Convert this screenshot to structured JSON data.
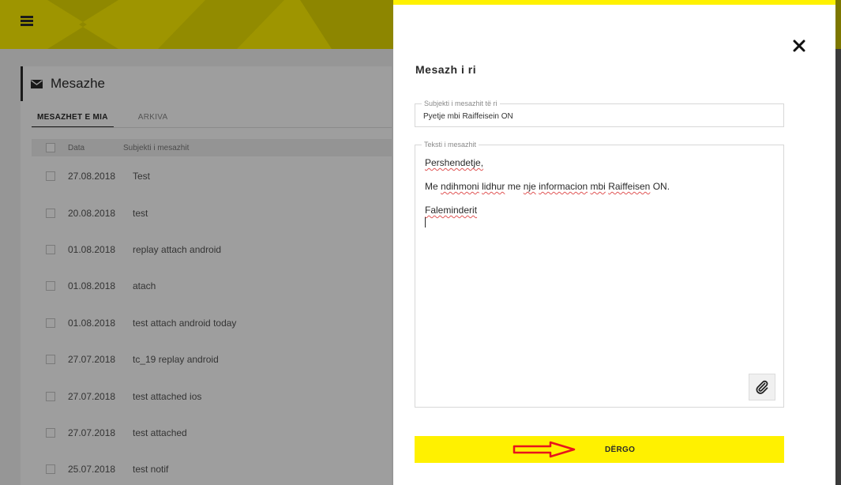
{
  "background": {
    "section_title": "Mesazhe",
    "tabs": [
      {
        "label": "MESAZHET E MIA",
        "active": true
      },
      {
        "label": "ARKIVA",
        "active": false
      }
    ],
    "table": {
      "headers": {
        "date": "Data",
        "subject": "Subjekti i mesazhit"
      },
      "rows": [
        {
          "date": "27.08.2018",
          "subject": "Test"
        },
        {
          "date": "20.08.2018",
          "subject": "test"
        },
        {
          "date": "01.08.2018",
          "subject": "replay attach android"
        },
        {
          "date": "01.08.2018",
          "subject": "atach"
        },
        {
          "date": "01.08.2018",
          "subject": "test attach android today"
        },
        {
          "date": "27.07.2018",
          "subject": "tc_19 replay android"
        },
        {
          "date": "27.07.2018",
          "subject": "test attached ios"
        },
        {
          "date": "27.07.2018",
          "subject": "test attached"
        },
        {
          "date": "25.07.2018",
          "subject": "test notif"
        }
      ]
    }
  },
  "modal": {
    "title": "Mesazh i ri",
    "subject_field": {
      "label": "Subjekti i mesazhit të ri",
      "value": "Pyetje mbi Raiffeisein ON"
    },
    "body_field": {
      "label": "Teksti i mesazhit",
      "lines": {
        "line1": "Pershendetje,",
        "line2_w1": "Me",
        "line2_w2": "ndihmoni",
        "line2_w3": "lidhur",
        "line2_w4": "me",
        "line2_w5": "nje",
        "line2_w6": "informacion",
        "line2_w7": "mbi",
        "line2_w8": "Raiffeisen",
        "line2_w9": "ON.",
        "line3": "Faleminderit"
      }
    },
    "send_label": "DËRGO"
  },
  "colors": {
    "brand_yellow": "#fff100",
    "dark": "#2a2a2a",
    "annotation_red": "#e8141c"
  },
  "icons": {
    "menu": "hamburger-icon",
    "mail": "envelope-icon",
    "close": "close-icon",
    "attach": "paperclip-icon",
    "annotation": "red-arrow-icon"
  }
}
